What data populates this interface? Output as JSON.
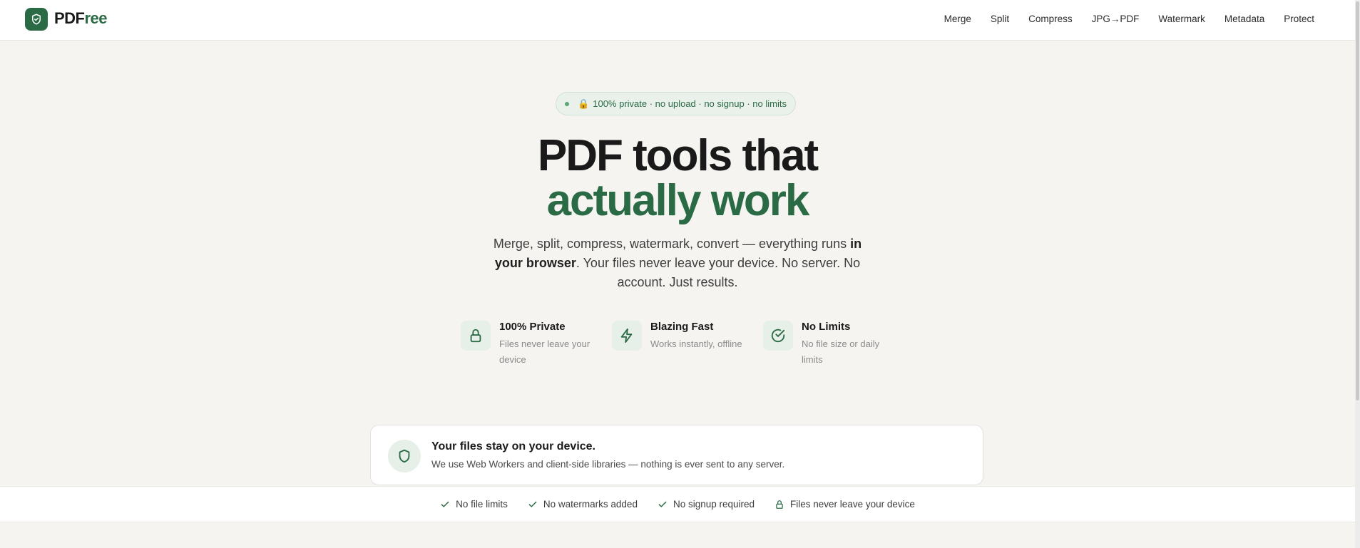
{
  "brand": {
    "name_part1": "PDF",
    "name_part2": "ree",
    "logo_icon": "shield-check-icon",
    "accent": "#2a6b45"
  },
  "nav": {
    "items": [
      {
        "label": "Merge"
      },
      {
        "label": "Split"
      },
      {
        "label": "Compress"
      },
      {
        "label": "JPG→PDF"
      },
      {
        "label": "Watermark"
      },
      {
        "label": "Metadata"
      },
      {
        "label": "Protect"
      }
    ]
  },
  "hero": {
    "badge": "100% private · no upload · no signup · no limits",
    "badge_icon": "lock-emoji",
    "title_line1": "PDF tools that",
    "title_line2": "actually work",
    "lead_part1": "Merge, split, compress, watermark, convert — everything runs ",
    "lead_bold": "in your browser",
    "lead_part2": ". Your files never leave your device. No server. No account. Just results."
  },
  "features": [
    {
      "title": "100% Private",
      "desc": "Files never leave your device",
      "icon": "lock-icon"
    },
    {
      "title": "Blazing Fast",
      "desc": "Works instantly, offline",
      "icon": "lightning-icon"
    },
    {
      "title": "No Limits",
      "desc": "No file size or daily limits",
      "icon": "check-circle-icon"
    }
  ],
  "privacy_card": {
    "title": "Your files stay on your device.",
    "desc": "We use Web Workers and client-side libraries — nothing is ever sent to any server.",
    "icon": "shield-icon"
  },
  "trust_strip": [
    {
      "label": "No file limits",
      "icon": "check-icon"
    },
    {
      "label": "No watermarks added",
      "icon": "check-icon"
    },
    {
      "label": "No signup required",
      "icon": "check-icon"
    },
    {
      "label": "Files never leave your device",
      "icon": "lock-icon"
    }
  ]
}
